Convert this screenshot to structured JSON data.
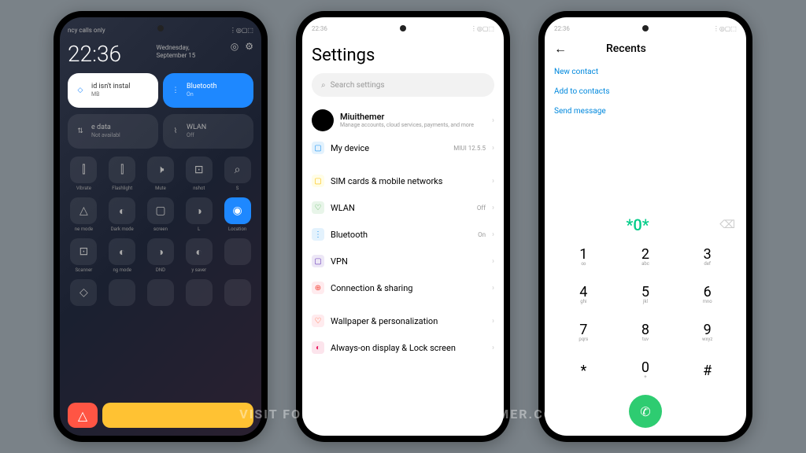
{
  "status": {
    "time": "22:36",
    "network": "ncy calls only",
    "icons": "⋮◎▢⬚"
  },
  "cc": {
    "time": "22:36",
    "date_day": "Wednesday,",
    "date_full": "September 15",
    "tiles": {
      "water": {
        "title": "id isn't instal",
        "sub": "MB"
      },
      "bt": {
        "title": "Bluetooth",
        "sub": "On"
      },
      "data": {
        "title": "e data",
        "sub": "Not availabl"
      },
      "wlan": {
        "title": "WLAN",
        "sub": "Off"
      }
    },
    "toggles": [
      {
        "label": "Vibrate"
      },
      {
        "label": "Flashlight"
      },
      {
        "label": "Mute"
      },
      {
        "label": "nshot"
      },
      {
        "label": "S"
      },
      {
        "label": "ne mode"
      },
      {
        "label": "Dark mode"
      },
      {
        "label": "screen"
      },
      {
        "label": "L"
      },
      {
        "label": "Location"
      },
      {
        "label": "Scanner"
      },
      {
        "label": "ng mode"
      },
      {
        "label": "DND"
      },
      {
        "label": "y saver"
      },
      {
        "label": ""
      },
      {
        "label": ""
      },
      {
        "label": ""
      },
      {
        "label": ""
      },
      {
        "label": ""
      },
      {
        "label": ""
      }
    ]
  },
  "settings": {
    "title": "Settings",
    "search_placeholder": "Search settings",
    "account": {
      "name": "Miuithemer",
      "sub": "Manage accounts, cloud services, payments, and more"
    },
    "items": [
      {
        "icon_bg": "#e3f2fd",
        "icon_color": "#2196f3",
        "glyph": "▢",
        "label": "My device",
        "value": "MIUI 12.5.5"
      },
      {
        "icon_bg": "#fffde7",
        "icon_color": "#ffc107",
        "glyph": "▢",
        "label": "SIM cards & mobile networks",
        "value": "",
        "gap": true
      },
      {
        "icon_bg": "#e8f5e9",
        "icon_color": "#4caf50",
        "glyph": "♡",
        "label": "WLAN",
        "value": "Off"
      },
      {
        "icon_bg": "#e3f2fd",
        "icon_color": "#2196f3",
        "glyph": "⋮",
        "label": "Bluetooth",
        "value": "On"
      },
      {
        "icon_bg": "#ede7f6",
        "icon_color": "#673ab7",
        "glyph": "▢",
        "label": "VPN",
        "value": ""
      },
      {
        "icon_bg": "#ffebee",
        "icon_color": "#f44336",
        "glyph": "⊕",
        "label": "Connection & sharing",
        "value": ""
      },
      {
        "icon_bg": "#ffebee",
        "icon_color": "#ff5722",
        "glyph": "♡",
        "label": "Wallpaper & personalization",
        "value": "",
        "gap": true
      },
      {
        "icon_bg": "#fce4ec",
        "icon_color": "#e91e63",
        "glyph": "◐",
        "label": "Always-on display & Lock screen",
        "value": ""
      }
    ]
  },
  "dialer": {
    "title": "Recents",
    "actions": [
      "New contact",
      "Add to contacts",
      "Send message"
    ],
    "number": "*0*",
    "keys": [
      {
        "n": "1",
        "s": "∞"
      },
      {
        "n": "2",
        "s": "abc"
      },
      {
        "n": "3",
        "s": "def"
      },
      {
        "n": "4",
        "s": "ghi"
      },
      {
        "n": "5",
        "s": "jkl"
      },
      {
        "n": "6",
        "s": "mno"
      },
      {
        "n": "7",
        "s": "pqrs"
      },
      {
        "n": "8",
        "s": "tuv"
      },
      {
        "n": "9",
        "s": "wxyz"
      },
      {
        "n": "*",
        "s": ""
      },
      {
        "n": "0",
        "s": "+"
      },
      {
        "n": "#",
        "s": ""
      }
    ]
  },
  "watermark": "VISIT FOR MORE THEMES - MIUITHEMER.COM"
}
